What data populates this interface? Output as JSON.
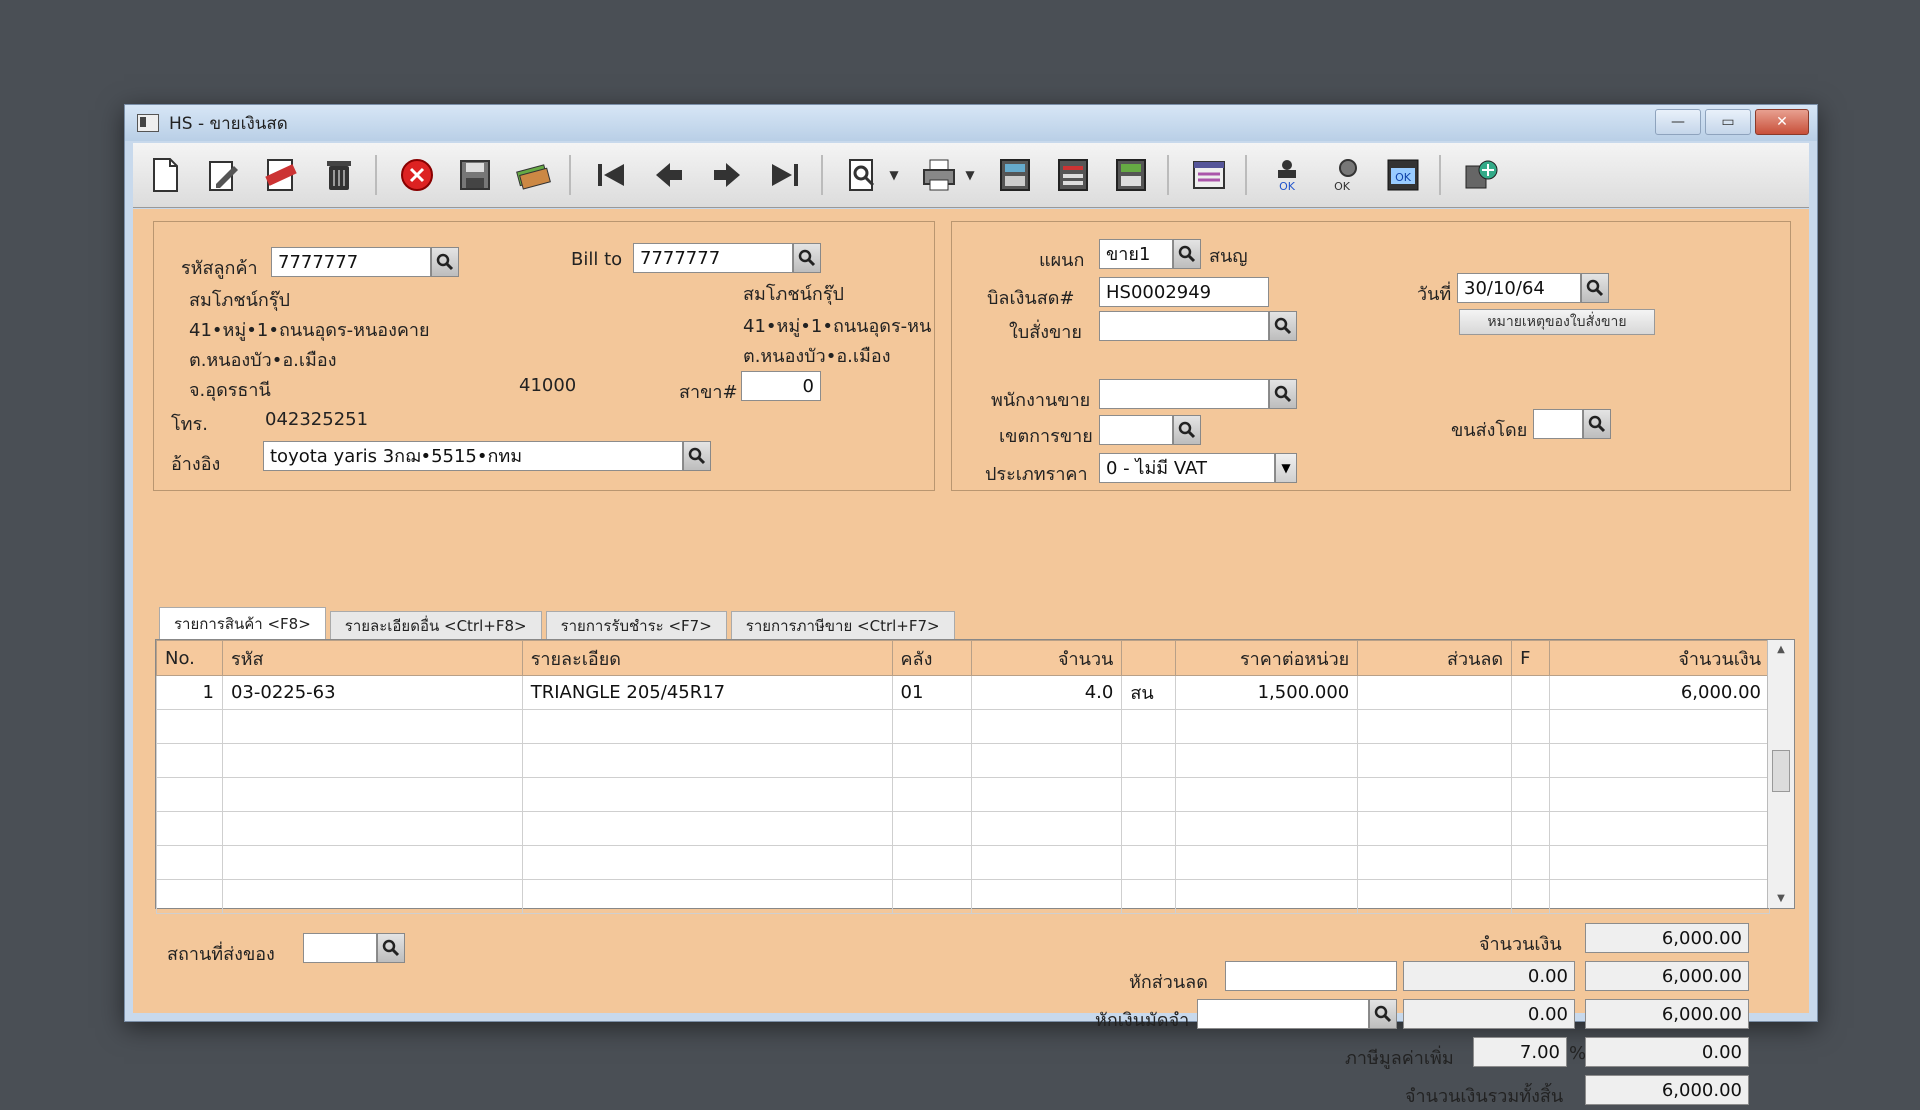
{
  "window": {
    "title": "HS - ขายเงินสด"
  },
  "titlebar_buttons": {
    "minimize": "—",
    "maximize": "▭",
    "close": "✕"
  },
  "toolbar": {
    "icons": [
      "new-document-icon",
      "edit-icon",
      "void-icon",
      "trash-icon",
      "cancel-icon",
      "save-icon",
      "money-icon",
      "first-record-icon",
      "previous-record-icon",
      "next-record-icon",
      "last-record-icon",
      "search-document-icon",
      "print-icon",
      "calculator-icon",
      "report-icon",
      "sales-report-icon",
      "database-icon",
      "approve-icon",
      "approve-print-icon",
      "approve-ok-icon",
      "network-icon"
    ]
  },
  "customer": {
    "code_label": "รหัสลูกค้า",
    "code": "7777777",
    "name": "สมโภชน์กรุ๊ป",
    "address1": "41•หมู่•1•ถนนอุดร-หนองคาย",
    "address2": "ต.หนองบัว•อ.เมือง",
    "province": "จ.อุดรธานี",
    "postcode": "41000",
    "phone_label": "โทร.",
    "phone": "042325251",
    "reference_label": "อ้างอิง",
    "reference": "toyota yaris 3กฌ•5515•กทม"
  },
  "bill_to": {
    "label": "Bill to",
    "code": "7777777",
    "name": "สมโภชน์กรุ๊ป",
    "address1": "41•หมู่•1•ถนนอุดร-หน",
    "address2": "ต.หนองบัว•อ.เมือง",
    "branch_label": "สาขา#",
    "branch": "0"
  },
  "document": {
    "department_label": "แผนก",
    "department": "ขาย1",
    "department_name": "สนญ",
    "bill_label": "บิลเงินสด#",
    "bill_no": "HS0002949",
    "order_label": "ใบสั่งขาย",
    "order": "",
    "date_label": "วันที่",
    "date": "30/10/64",
    "memo_button": "หมายเหตุของใบสั่งขาย",
    "salesperson_label": "พนักงานขาย",
    "salesperson": "",
    "area_label": "เขตการขาย",
    "area": "",
    "shipping_label": "ขนส่งโดย",
    "shipping": "",
    "price_type_label": "ประเภทราคา",
    "price_type": "0 - ไม่มี VAT"
  },
  "tabs": [
    {
      "label": "รายการสินค้า <F8>"
    },
    {
      "label": "รายละเอียดอื่น <Ctrl+F8>"
    },
    {
      "label": "รายการรับชำระ <F7>"
    },
    {
      "label": "รายการภาษีขาย <Ctrl+F7>"
    }
  ],
  "grid": {
    "headers": [
      "No.",
      "รหัส",
      "รายละเอียด",
      "คลัง",
      "จำนวน",
      "",
      "ราคาต่อหน่วย",
      "ส่วนลด",
      "F",
      "จำนวนเงิน"
    ],
    "rows": [
      [
        "1",
        "03-0225-63",
        "TRIANGLE 205/45R17",
        "01",
        "4.0",
        "สน",
        "1,500.000",
        "",
        "",
        "6,000.00"
      ]
    ]
  },
  "footer": {
    "delivery_label": "สถานที่ส่งของ",
    "delivery": "",
    "amount_label": "จำนวนเงิน",
    "amount": "6,000.00",
    "discount_label": "หักส่วนลด",
    "discount_input": "",
    "discount_value": "0.00",
    "discount_total": "6,000.00",
    "deposit_label": "หักเงินมัดจำ",
    "deposit_input": "",
    "deposit_value": "0.00",
    "deposit_total": "6,000.00",
    "vat_label": "ภาษีมูลค่าเพิ่ม",
    "vat_rate": "7.00",
    "vat_percent": "%",
    "vat_amount": "0.00",
    "grand_total_label": "จำนวนเงินรวมทั้งสิ้น",
    "grand_total": "6,000.00"
  }
}
